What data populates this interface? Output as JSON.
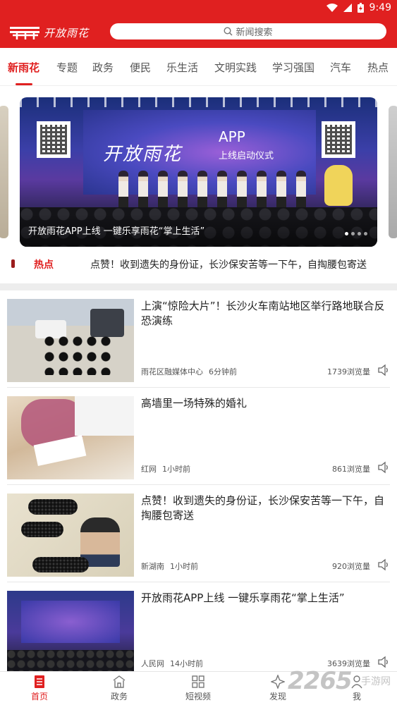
{
  "status_bar": {
    "time": "9:49"
  },
  "header": {
    "logo_text": "开放雨花",
    "search_placeholder": "新闻搜索"
  },
  "tabs": [
    {
      "label": "新雨花",
      "active": true
    },
    {
      "label": "专题"
    },
    {
      "label": "政务"
    },
    {
      "label": "便民"
    },
    {
      "label": "乐生活"
    },
    {
      "label": "文明实践"
    },
    {
      "label": "学习强国"
    },
    {
      "label": "汽车"
    },
    {
      "label": "热点"
    }
  ],
  "carousel": {
    "caption": "开放雨花APP上线 一键乐享雨花“掌上生活”",
    "art_title": "开放雨花",
    "art_app": "APP",
    "art_subtitle": "上线启动仪式",
    "dot_count": 4,
    "active_dot": 0
  },
  "hot": {
    "label": "热点",
    "text": "点赞！收到遗失的身份证，长沙保安苦等一下午，自掏腰包寄送"
  },
  "news": [
    {
      "title": "上演“惊险大片”！长沙火车南站地区举行路地联合反恐演练",
      "source": "雨花区融媒体中心",
      "time": "6分钟前",
      "views": "1739浏览量"
    },
    {
      "title": "高墙里一场特殊的婚礼",
      "source": "红网",
      "time": "1小时前",
      "views": "861浏览量"
    },
    {
      "title": "点赞！收到遗失的身份证，长沙保安苦等一下午，自掏腰包寄送",
      "source": "新湖南",
      "time": "1小时前",
      "views": "920浏览量"
    },
    {
      "title": "开放雨花APP上线 一键乐享雨花“掌上生活”",
      "source": "人民网",
      "time": "14小时前",
      "views": "3639浏览量"
    }
  ],
  "bottom_nav": [
    {
      "label": "首页",
      "icon": "home-doc-icon",
      "active": true
    },
    {
      "label": "政务",
      "icon": "government-building-icon"
    },
    {
      "label": "短视频",
      "icon": "grid-icon"
    },
    {
      "label": "发现",
      "icon": "star-compass-icon"
    },
    {
      "label": "我",
      "icon": "person-icon"
    }
  ],
  "watermark": {
    "number": "2265",
    "suffix": "手游网"
  },
  "colors": {
    "brand_red": "#e02020"
  }
}
